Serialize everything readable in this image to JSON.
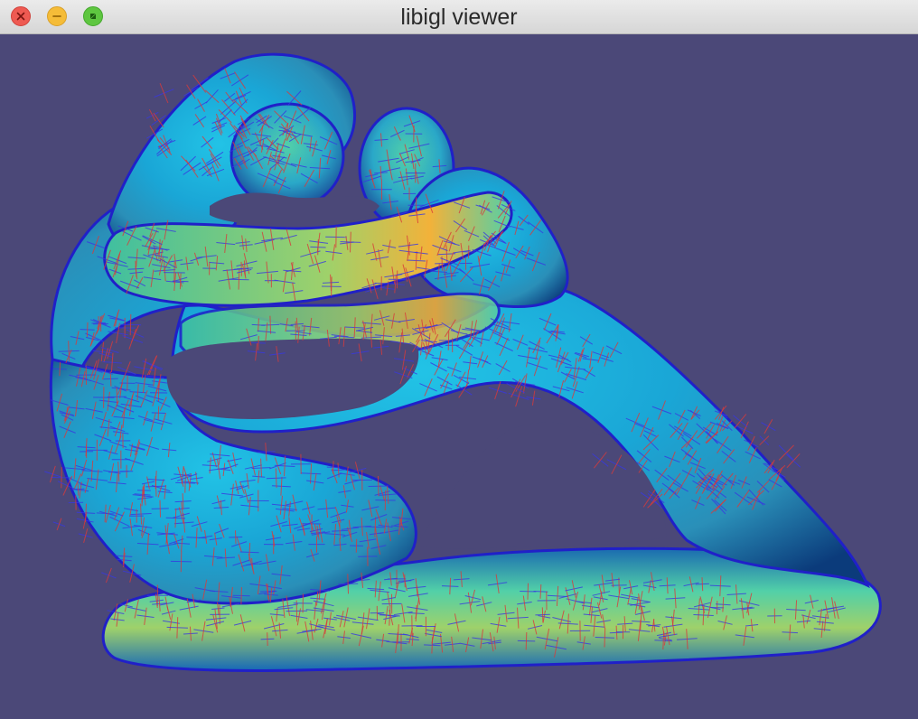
{
  "window": {
    "title": "libigl viewer",
    "buttons": {
      "close": "close-icon",
      "minimize": "minimize-icon",
      "maximize": "fullscreen-icon"
    }
  },
  "viewport": {
    "background_color": "#4b4878",
    "model": "sculpture-mesh",
    "surface_colormap": [
      "#0b2b6b",
      "#1668b8",
      "#22c3e6",
      "#52d0a8",
      "#9fd16a",
      "#f2b23a"
    ],
    "field_colors": {
      "primary_direction": "#d93a3a",
      "secondary_direction": "#3838e0"
    }
  }
}
